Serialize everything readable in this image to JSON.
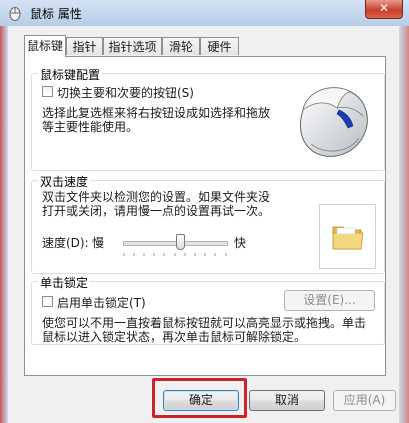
{
  "window": {
    "title": "鼠标 属性",
    "close_symbol": "✕"
  },
  "tabs": [
    {
      "label": "鼠标键",
      "active": true
    },
    {
      "label": "指针",
      "active": false
    },
    {
      "label": "指针选项",
      "active": false
    },
    {
      "label": "滑轮",
      "active": false
    },
    {
      "label": "硬件",
      "active": false
    }
  ],
  "buttons_group": {
    "title": "鼠标键配置",
    "swap_checkbox_label": "切换主要和次要的按钮(S)",
    "swap_checked": false,
    "description_line1": "选择此复选框来将右按钮设成如选择和拖放",
    "description_line2": "等主要性能使用。"
  },
  "double_click_group": {
    "title": "双击速度",
    "description_line1": "双击文件夹以检测您的设置。如果文件夹没",
    "description_line2": "打开或关闭，请用慢一点的设置再试一次。",
    "speed_label": "速度(D):",
    "slow_label": "慢",
    "fast_label": "快",
    "speed_value": 0.55
  },
  "click_lock_group": {
    "title": "单击锁定",
    "enable_checkbox_label": "启用单击锁定(T)",
    "enable_checked": false,
    "settings_button": "设置(E)...",
    "description_line1": "使您可以不用一直按着鼠标按钮就可以高亮显示或拖拽。单击",
    "description_line2": "鼠标以进入锁定状态，再次单击鼠标可解除锁定。"
  },
  "footer": {
    "ok_label": "确定",
    "cancel_label": "取消",
    "apply_label": "应用(A)"
  },
  "colors": {
    "highlight_box": "#c8262b",
    "accent": "#3c7fb1"
  }
}
